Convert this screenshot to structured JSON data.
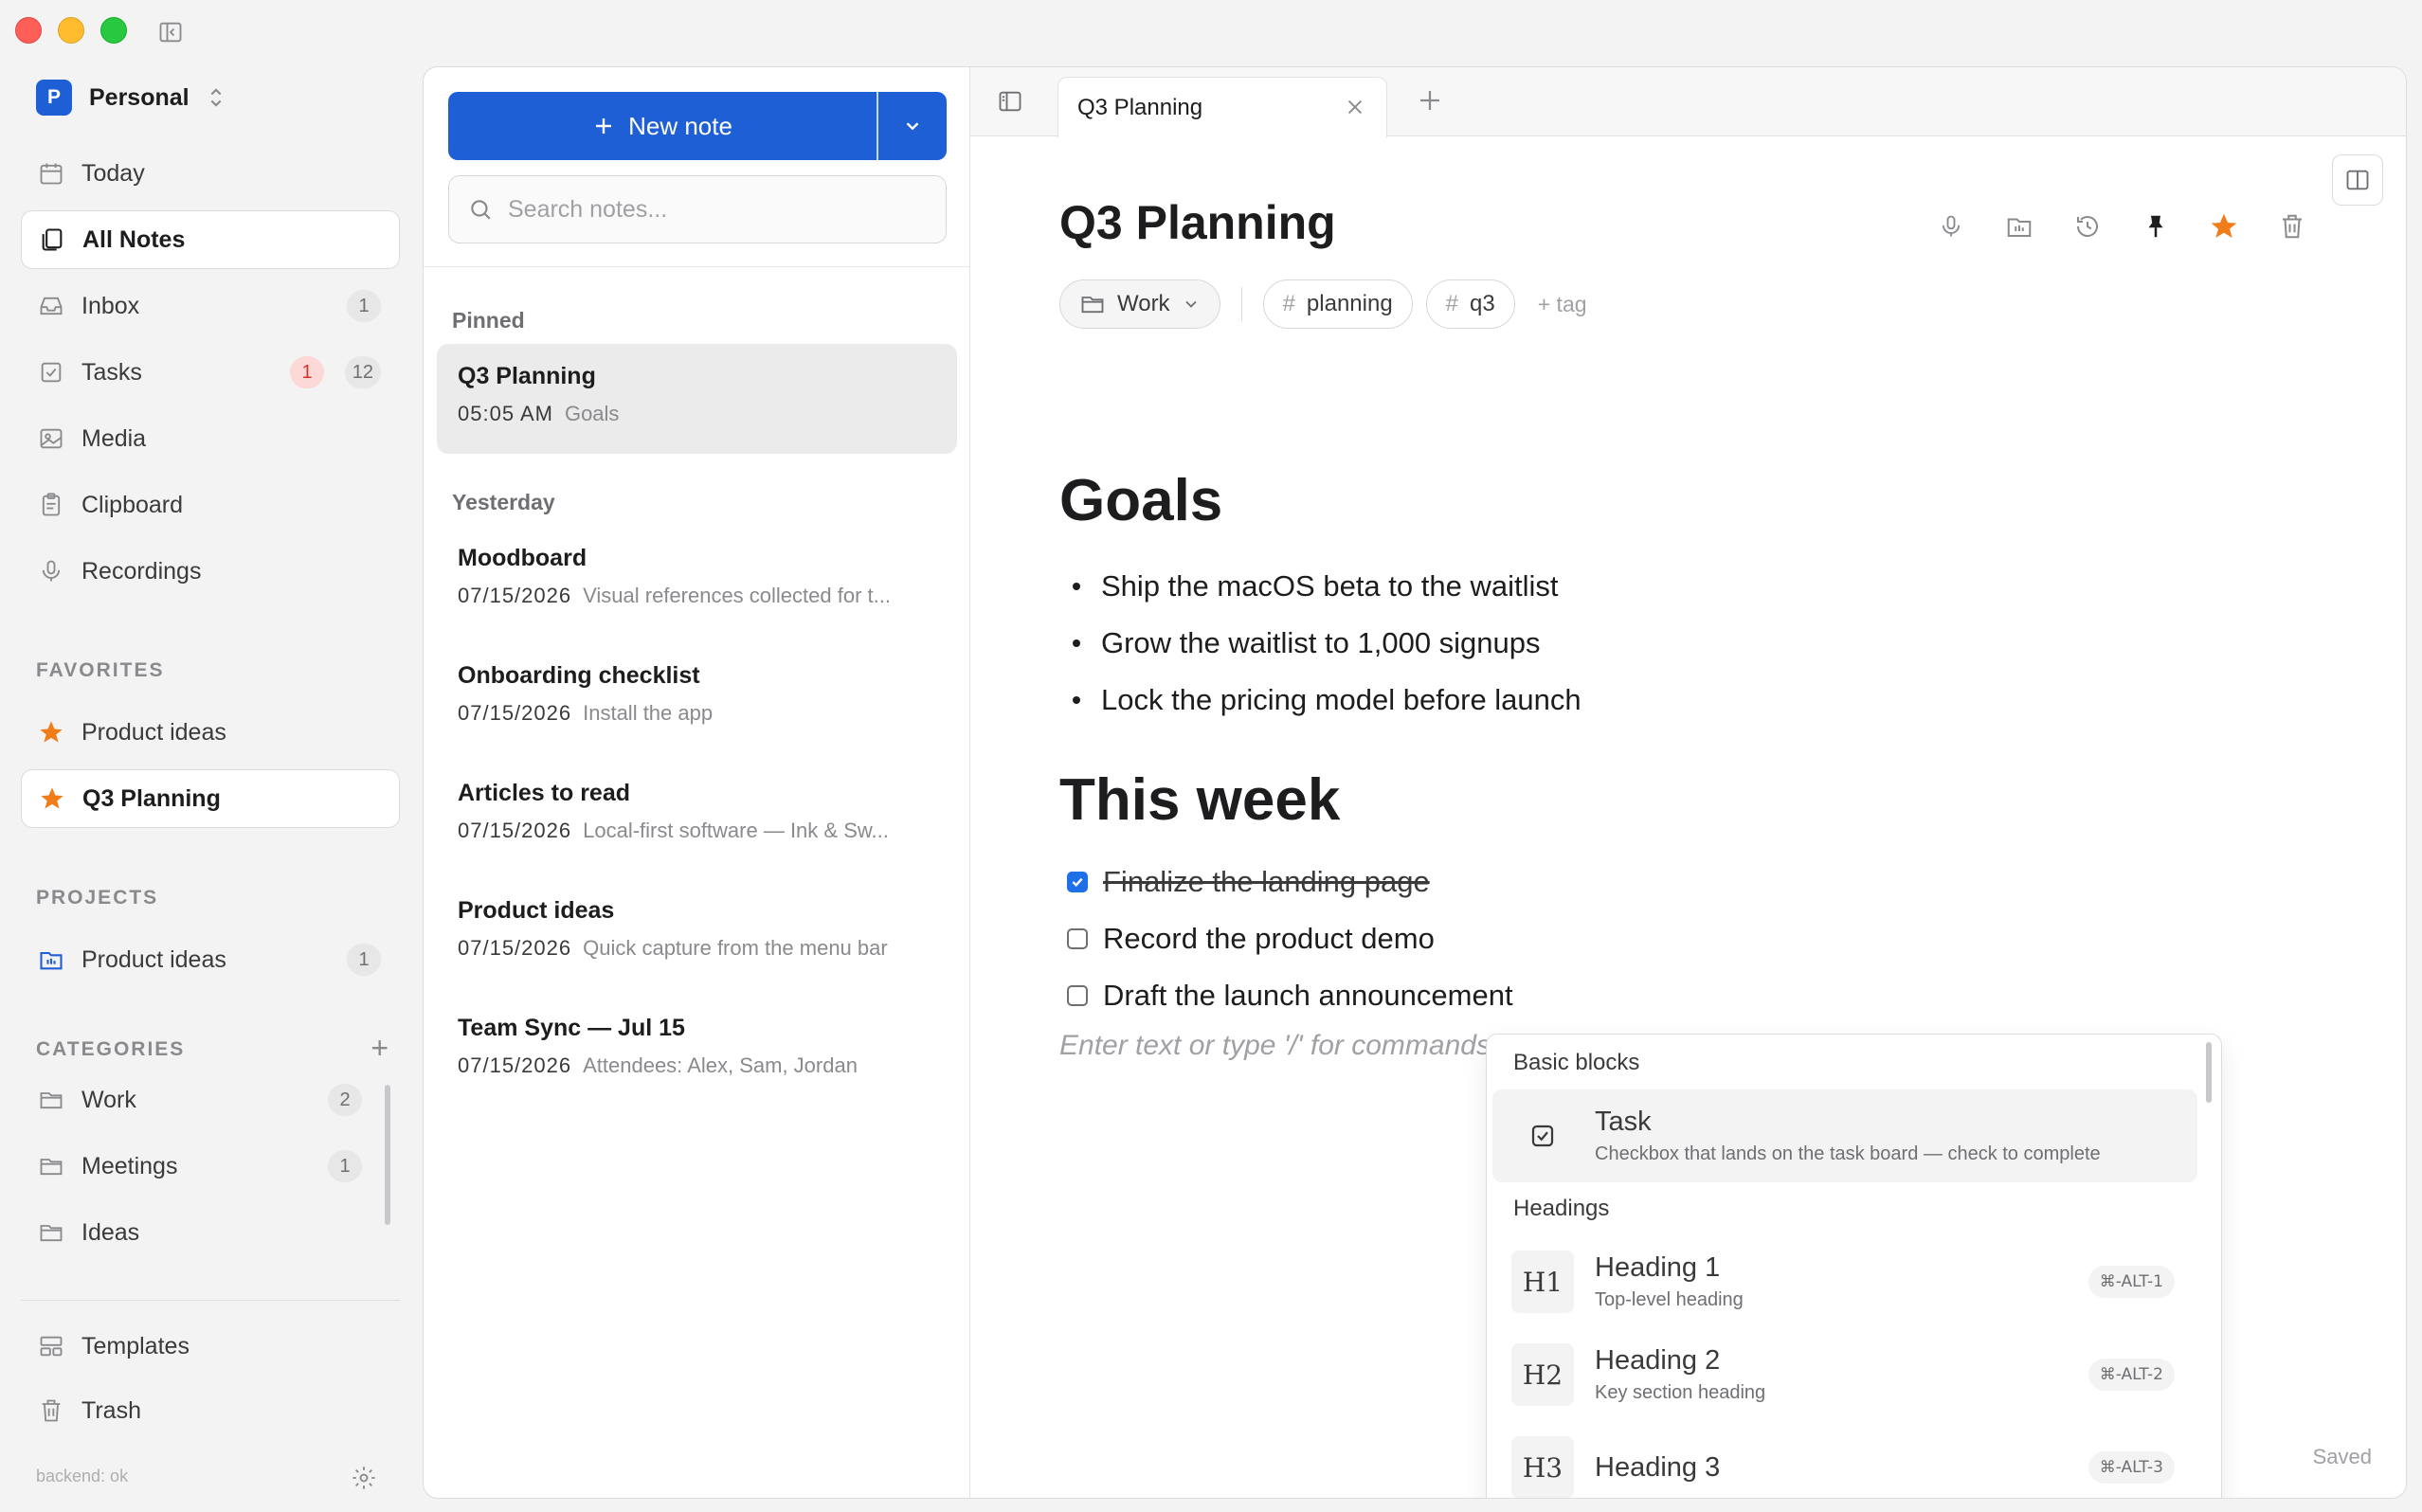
{
  "workspace": {
    "badge": "P",
    "name": "Personal"
  },
  "sidebar": {
    "nav": [
      {
        "label": "Today",
        "icon": "calendar-icon"
      },
      {
        "label": "All Notes",
        "icon": "notes-icon"
      },
      {
        "label": "Inbox",
        "icon": "inbox-icon",
        "count": "1"
      },
      {
        "label": "Tasks",
        "icon": "tasks-icon",
        "alert": "1",
        "count": "12"
      },
      {
        "label": "Media",
        "icon": "image-icon"
      },
      {
        "label": "Clipboard",
        "icon": "clipboard-icon"
      },
      {
        "label": "Recordings",
        "icon": "mic-icon"
      }
    ],
    "favorites_label": "FAVORITES",
    "favorites": [
      {
        "label": "Product ideas",
        "icon": "star-icon"
      },
      {
        "label": "Q3 Planning",
        "icon": "star-icon"
      }
    ],
    "projects_label": "PROJECTS",
    "projects": [
      {
        "label": "Product ideas",
        "icon": "project-folder-icon",
        "count": "1"
      }
    ],
    "categories_label": "CATEGORIES",
    "categories": [
      {
        "label": "Work",
        "icon": "folder-icon",
        "count": "2"
      },
      {
        "label": "Meetings",
        "icon": "folder-icon",
        "count": "1"
      },
      {
        "label": "Ideas",
        "icon": "folder-icon"
      }
    ],
    "templates_label": "Templates",
    "trash_label": "Trash",
    "backend_status": "backend: ok"
  },
  "note_list": {
    "new_note_label": "New note",
    "search_placeholder": "Search notes...",
    "groups": [
      {
        "label": "Pinned",
        "notes": [
          {
            "title": "Q3 Planning",
            "date": "05:05 AM",
            "snippet": "Goals"
          }
        ]
      },
      {
        "label": "Yesterday",
        "notes": [
          {
            "title": "Moodboard",
            "date": "07/15/2026",
            "snippet": "Visual references collected for t..."
          },
          {
            "title": "Onboarding checklist",
            "date": "07/15/2026",
            "snippet": "Install the app"
          },
          {
            "title": "Articles to read",
            "date": "07/15/2026",
            "snippet": "Local-first software — Ink & Sw..."
          },
          {
            "title": "Product ideas",
            "date": "07/15/2026",
            "snippet": "Quick capture from the menu bar"
          },
          {
            "title": "Team Sync — Jul 15",
            "date": "07/15/2026",
            "snippet": "Attendees: Alex, Sam, Jordan"
          }
        ]
      }
    ]
  },
  "editor": {
    "tab_title": "Q3 Planning",
    "title": "Q3 Planning",
    "folder": "Work",
    "tags": [
      "planning",
      "q3"
    ],
    "add_tag_label": "+ tag",
    "toolbar_icons": [
      "mic-icon",
      "folder-move-icon",
      "history-icon",
      "pin-icon",
      "star-icon",
      "trash-icon"
    ],
    "accent": "#1f5fd6",
    "star_color": "#f07c1a",
    "h_goals": "Goals",
    "goals": [
      "Ship the macOS beta to the waitlist",
      "Grow the waitlist to 1,000 signups",
      "Lock the pricing model before launch"
    ],
    "h_week": "This week",
    "tasks": [
      {
        "text": "Finalize the landing page",
        "done": true
      },
      {
        "text": "Record the product demo",
        "done": false
      },
      {
        "text": "Draft the launch announcement",
        "done": false
      }
    ],
    "placeholder": "Enter text or type '/' for commands",
    "status": "Saved"
  },
  "slash_menu": {
    "basic_label": "Basic blocks",
    "task": {
      "title": "Task",
      "desc": "Checkbox that lands on the task board — check to complete"
    },
    "headings_label": "Headings",
    "headings": [
      {
        "icon": "H1",
        "title": "Heading 1",
        "desc": "Top-level heading",
        "shortcut": "⌘-ALT-1"
      },
      {
        "icon": "H2",
        "title": "Heading 2",
        "desc": "Key section heading",
        "shortcut": "⌘-ALT-2"
      },
      {
        "icon": "H3",
        "title": "Heading 3",
        "desc": "",
        "shortcut": "⌘-ALT-3"
      }
    ]
  }
}
